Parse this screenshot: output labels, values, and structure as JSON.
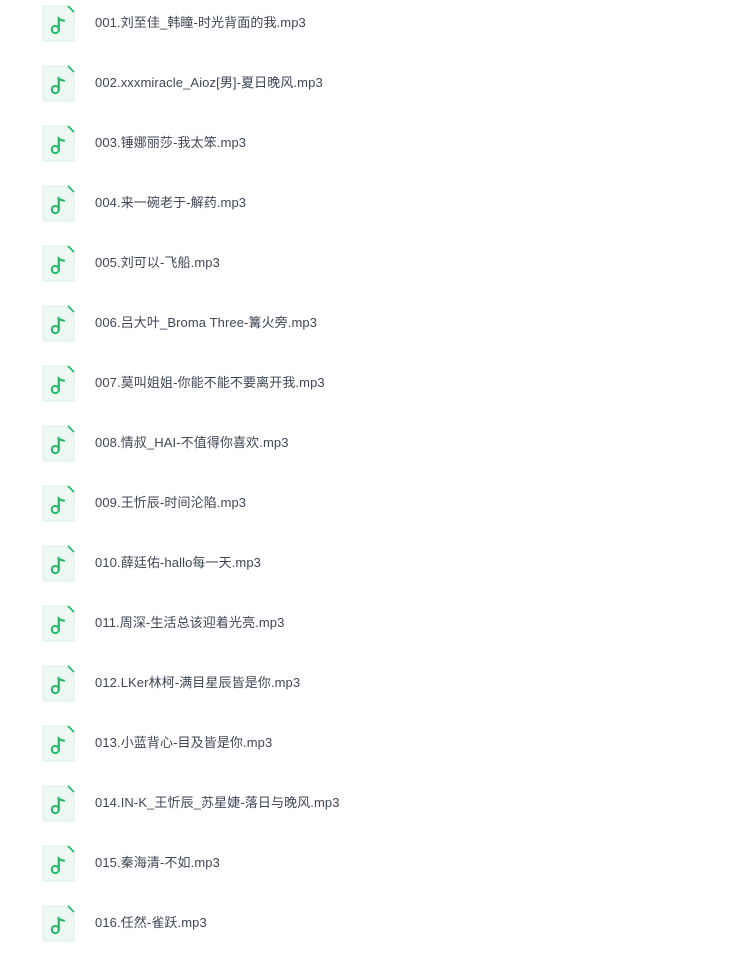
{
  "file_list": {
    "icon": "music-file-icon",
    "colors": {
      "icon_background": "#edf8f2",
      "icon_border": "#dcefe4",
      "icon_accent": "#27b86a",
      "text": "#3f4654"
    },
    "items": [
      {
        "name": "001.刘至佳_韩瞳-时光背面的我.mp3"
      },
      {
        "name": "002.xxxmiracle_Aioz[男]-夏日晚风.mp3"
      },
      {
        "name": "003.锤娜丽莎-我太笨.mp3"
      },
      {
        "name": "004.来一碗老于-解药.mp3"
      },
      {
        "name": "005.刘可以-飞船.mp3"
      },
      {
        "name": "006.吕大叶_Broma Three-篝火旁.mp3"
      },
      {
        "name": "007.莫叫姐姐-你能不能不要离开我.mp3"
      },
      {
        "name": "008.情叔_HAI-不值得你喜欢.mp3"
      },
      {
        "name": "009.王忻辰-时间沦陷.mp3"
      },
      {
        "name": "010.薛廷佑-hallo每一天.mp3"
      },
      {
        "name": "011.周深-生活总该迎着光亮.mp3"
      },
      {
        "name": "012.LKer林柯-满目星辰皆是你.mp3"
      },
      {
        "name": "013.小蓝背心-目及皆是你.mp3"
      },
      {
        "name": "014.IN-K_王忻辰_苏星婕-落日与晚风.mp3"
      },
      {
        "name": "015.秦海清-不如.mp3"
      },
      {
        "name": "016.任然-雀跃.mp3"
      }
    ]
  }
}
